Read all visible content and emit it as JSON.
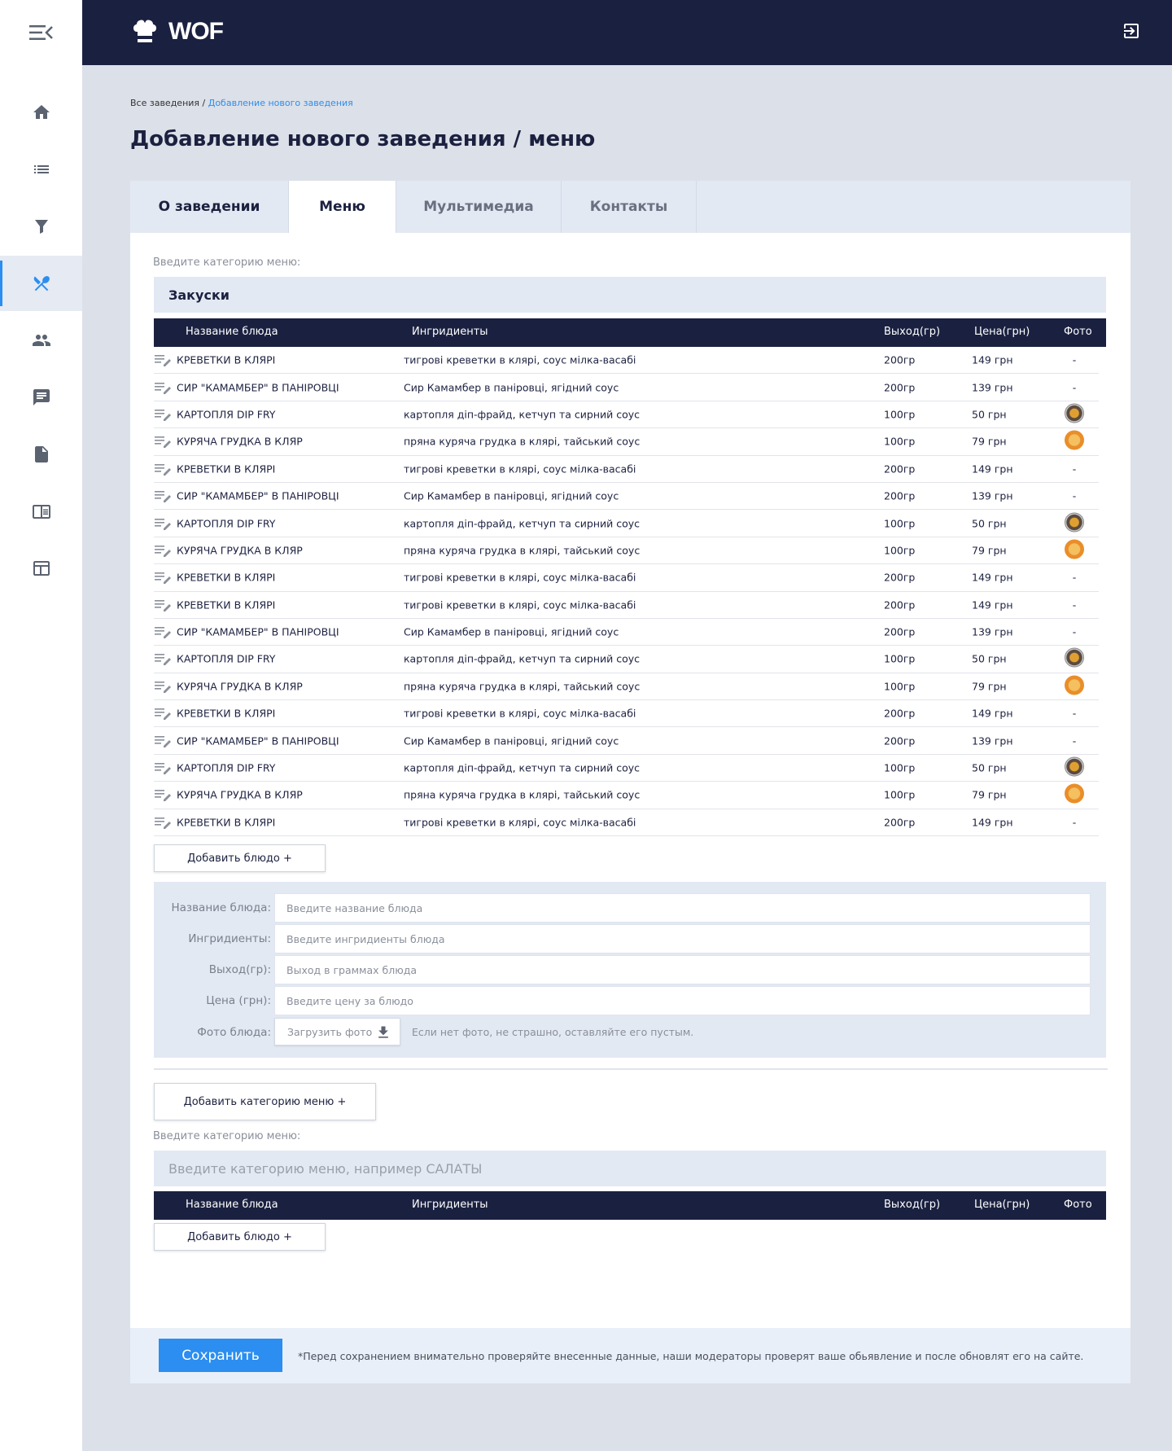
{
  "app": {
    "logo_text": "WOF"
  },
  "breadcrumb": {
    "parent": "Все заведения",
    "separator": " / ",
    "current": "Добавление нового заведения"
  },
  "page_title": "Добавление нового заведения / меню",
  "tabs": [
    {
      "label": "О заведении"
    },
    {
      "label": "Меню"
    },
    {
      "label": "Мультимедиа"
    },
    {
      "label": "Контакты"
    }
  ],
  "category_label": "Введите категорию меню:",
  "category1": {
    "value": "Закуски"
  },
  "columns": {
    "name": "Название блюда",
    "ingredients": "Ингридиенты",
    "output": "Выход(гр)",
    "price": "Цена(грн)",
    "photo": "Фото"
  },
  "rows": [
    {
      "name": "КРЕВЕТКИ В КЛЯРІ",
      "ingredients": "тигрові креветки в клярі, соус мілка-васабі",
      "output": "200гр",
      "price": "149 грн",
      "photo": "-"
    },
    {
      "name": "СИР \"КАМАМБЕР\" В ПАНІРОВЦІ",
      "ingredients": "Сир Камамбер в паніровці, ягідний соус",
      "output": "200гр",
      "price": "139 грн",
      "photo": "-"
    },
    {
      "name": "КАРТОПЛЯ DIP FRY",
      "ingredients": "картопля діп-фрайд, кетчуп та сирний соус",
      "output": "100гр",
      "price": "50 грн",
      "photo": "fries-photo"
    },
    {
      "name": "КУРЯЧА ГРУДКА В КЛЯР",
      "ingredients": "пряна куряча грудка в клярі, тайський соус",
      "output": "100гр",
      "price": "79 грн",
      "photo": "chicken-photo"
    },
    {
      "name": "КРЕВЕТКИ В КЛЯРІ",
      "ingredients": "тигрові креветки в клярі, соус мілка-васабі",
      "output": "200гр",
      "price": "149 грн",
      "photo": "-"
    },
    {
      "name": "СИР \"КАМАМБЕР\" В ПАНІРОВЦІ",
      "ingredients": "Сир Камамбер в паніровці, ягідний соус",
      "output": "200гр",
      "price": "139 грн",
      "photo": "-"
    },
    {
      "name": "КАРТОПЛЯ DIP FRY",
      "ingredients": "картопля діп-фрайд, кетчуп та сирний соус",
      "output": "100гр",
      "price": "50 грн",
      "photo": "fries-photo"
    },
    {
      "name": "КУРЯЧА ГРУДКА В КЛЯР",
      "ingredients": "пряна куряча грудка в клярі, тайський соус",
      "output": "100гр",
      "price": "79 грн",
      "photo": "chicken-photo"
    },
    {
      "name": "КРЕВЕТКИ В КЛЯРІ",
      "ingredients": "тигрові креветки в клярі, соус мілка-васабі",
      "output": "200гр",
      "price": "149 грн",
      "photo": "-"
    },
    {
      "name": "КРЕВЕТКИ В КЛЯРІ",
      "ingredients": "тигрові креветки в клярі, соус мілка-васабі",
      "output": "200гр",
      "price": "149 грн",
      "photo": "-"
    },
    {
      "name": "СИР \"КАМАМБЕР\" В ПАНІРОВЦІ",
      "ingredients": "Сир Камамбер в паніровці, ягідний соус",
      "output": "200гр",
      "price": "139 грн",
      "photo": "-"
    },
    {
      "name": "КАРТОПЛЯ DIP FRY",
      "ingredients": "картопля діп-фрайд, кетчуп та сирний соус",
      "output": "100гр",
      "price": "50 грн",
      "photo": "fries-photo"
    },
    {
      "name": "КУРЯЧА ГРУДКА В КЛЯР",
      "ingredients": "пряна куряча грудка в клярі, тайський соус",
      "output": "100гр",
      "price": "79 грн",
      "photo": "chicken-photo"
    },
    {
      "name": "КРЕВЕТКИ В КЛЯРІ",
      "ingredients": "тигрові креветки в клярі, соус мілка-васабі",
      "output": "200гр",
      "price": "149 грн",
      "photo": "-"
    },
    {
      "name": "СИР \"КАМАМБЕР\" В ПАНІРОВЦІ",
      "ingredients": "Сир Камамбер в паніровці, ягідний соус",
      "output": "200гр",
      "price": "139 грн",
      "photo": "-"
    },
    {
      "name": "КАРТОПЛЯ DIP FRY",
      "ingredients": "картопля діп-фрайд, кетчуп та сирний соус",
      "output": "100гр",
      "price": "50 грн",
      "photo": "fries-photo"
    },
    {
      "name": "КУРЯЧА ГРУДКА В КЛЯР",
      "ingredients": "пряна куряча грудка в клярі, тайський соус",
      "output": "100гр",
      "price": "79 грн",
      "photo": "chicken-photo"
    },
    {
      "name": "КРЕВЕТКИ В КЛЯРІ",
      "ingredients": "тигрові креветки в клярі, соус мілка-васабі",
      "output": "200гр",
      "price": "149 грн",
      "photo": "-"
    }
  ],
  "add_dish_label": "Добавить блюдо +",
  "form": {
    "name_label": "Название блюда:",
    "name_placeholder": "Введите название блюда",
    "ingredients_label": "Ингридиенты:",
    "ingredients_placeholder": "Введите ингридиенты блюда",
    "output_label": "Выход(гр):",
    "output_placeholder": "Выход в граммах блюда",
    "price_label": "Цена (грн):",
    "price_placeholder": "Введите цену за блюдо",
    "photo_label": "Фото блюда:",
    "upload_label": "Загрузить фото",
    "photo_hint": "Если нет фото, не страшно, оставляйте его пустым."
  },
  "add_category_label": "Добавить категорию меню +",
  "category2": {
    "placeholder": "Введите категорию меню, например САЛАТЫ"
  },
  "footer": {
    "save_label": "Сохранить",
    "note": "*Перед сохранением внимательно проверяйте внесенные данные, наши модераторы проверят ваше обьявление и после обновлят его на сайте."
  },
  "colors": {
    "navy": "#1a2140",
    "accent": "#2b8ef0",
    "panel": "#e3e9f3",
    "background": "#dce0e8"
  },
  "sidebar_icons": [
    "menu-collapse-icon",
    "home-icon",
    "list-icon",
    "filter-icon",
    "utensils-icon",
    "users-icon",
    "chat-icon",
    "document-icon",
    "newspaper-icon",
    "table-icon"
  ]
}
